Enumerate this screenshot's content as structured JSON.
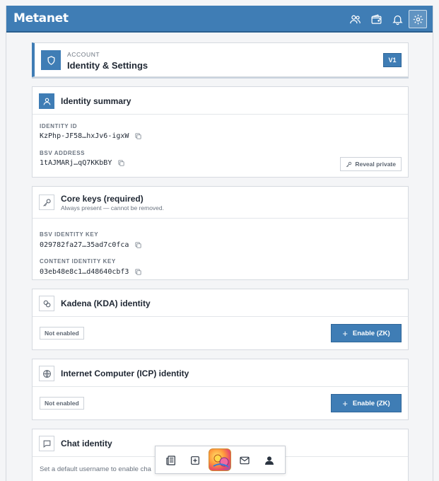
{
  "app": {
    "brand": "Metanet"
  },
  "header": {
    "eyebrow": "ACCOUNT",
    "title": "Identity & Settings",
    "version": "V1"
  },
  "identity_summary": {
    "title": "Identity summary",
    "identity_id_label": "IDENTITY ID",
    "identity_id_value": "KzPhp-JF58…hxJv6-igxW",
    "bsv_address_label": "BSV ADDRESS",
    "bsv_address_value": "1tAJMARj…qQ7KKbBY",
    "reveal_label": "Reveal private"
  },
  "core_keys": {
    "title": "Core keys (required)",
    "subtitle": "Always present — cannot be removed.",
    "bsv_key_label": "BSV IDENTITY KEY",
    "bsv_key_value": "029782fa27…35ad7c0fca",
    "content_key_label": "CONTENT IDENTITY KEY",
    "content_key_value": "03eb48e8c1…d48640cbf3"
  },
  "kadena": {
    "title": "Kadena (KDA) identity",
    "status": "Not enabled",
    "button_label": "Enable (ZK)"
  },
  "icp": {
    "title": "Internet Computer (ICP) identity",
    "status": "Not enabled",
    "button_label": "Enable (ZK)"
  },
  "chat": {
    "title": "Chat identity",
    "description": "Set a default username to enable cha"
  },
  "colors": {
    "accent": "#3f7db5",
    "accent_dark": "#2b5f8e"
  }
}
